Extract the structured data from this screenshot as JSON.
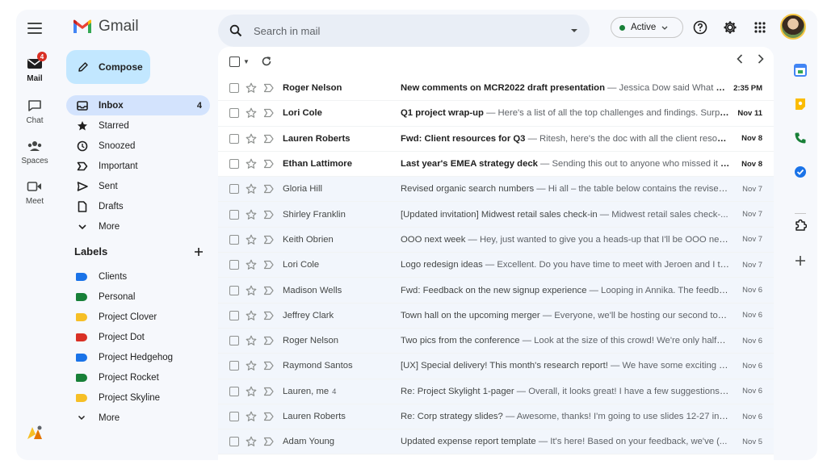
{
  "app": {
    "name": "Gmail"
  },
  "rail": {
    "items": [
      {
        "label": "Mail",
        "badge": "4"
      },
      {
        "label": "Chat"
      },
      {
        "label": "Spaces"
      },
      {
        "label": "Meet"
      }
    ]
  },
  "compose": {
    "label": "Compose"
  },
  "nav": [
    {
      "label": "Inbox",
      "count": "4",
      "icon": "inbox-icon"
    },
    {
      "label": "Starred",
      "icon": "star-icon"
    },
    {
      "label": "Snoozed",
      "icon": "clock-icon"
    },
    {
      "label": "Important",
      "icon": "important-icon"
    },
    {
      "label": "Sent",
      "icon": "send-icon"
    },
    {
      "label": "Drafts",
      "icon": "draft-icon"
    },
    {
      "label": "More",
      "icon": "chevron-down-icon"
    }
  ],
  "labels": {
    "heading": "Labels",
    "items": [
      {
        "label": "Clients",
        "color": "#1a73e8"
      },
      {
        "label": "Personal",
        "color": "#188038"
      },
      {
        "label": "Project Clover",
        "color": "#f6bf26"
      },
      {
        "label": "Project Dot",
        "color": "#d93025"
      },
      {
        "label": "Project Hedgehog",
        "color": "#1a73e8"
      },
      {
        "label": "Project Rocket",
        "color": "#188038"
      },
      {
        "label": "Project Skyline",
        "color": "#f6bf26"
      }
    ],
    "more": "More"
  },
  "search": {
    "placeholder": "Search in mail"
  },
  "status": {
    "label": "Active",
    "color": "#188038"
  },
  "emails": [
    {
      "sender": "Roger Nelson",
      "subject": "New comments on MCR2022 draft presentation",
      "snippet": " — Jessica Dow said What ab...",
      "date": "2:35 PM",
      "unread": true
    },
    {
      "sender": "Lori Cole",
      "subject": "Q1 project wrap-up",
      "snippet": " — Here's a list of all the top challenges and findings. Surpri...",
      "date": "Nov 11",
      "unread": true
    },
    {
      "sender": "Lauren Roberts",
      "subject": "Fwd: Client resources for Q3",
      "snippet": " — Ritesh, here's the doc with all the client resour...",
      "date": "Nov 8",
      "unread": true
    },
    {
      "sender": "Ethan Lattimore",
      "subject": "Last year's EMEA strategy deck",
      "snippet": " — Sending this out to anyone who missed it R...",
      "date": "Nov 8",
      "unread": true
    },
    {
      "sender": "Gloria Hill",
      "subject": "Revised organic search numbers",
      "snippet": " — Hi all – the table below contains the revised...",
      "date": "Nov 7",
      "unread": false
    },
    {
      "sender": "Shirley Franklin",
      "subject": "[Updated invitation] Midwest retail sales check-in",
      "snippet": " — Midwest retail sales check-...",
      "date": "Nov 7",
      "unread": false
    },
    {
      "sender": "Keith Obrien",
      "subject": "OOO next week",
      "snippet": " — Hey, just wanted to give you a heads-up that I'll be OOO next...",
      "date": "Nov 7",
      "unread": false
    },
    {
      "sender": "Lori Cole",
      "subject": "Logo redesign ideas",
      "snippet": " — Excellent. Do you have time to meet with Jeroen and I thi...",
      "date": "Nov 7",
      "unread": false
    },
    {
      "sender": "Madison Wells",
      "subject": "Fwd: Feedback on the new signup experience",
      "snippet": " — Looping in Annika. The feedbac...",
      "date": "Nov 6",
      "unread": false
    },
    {
      "sender": "Jeffrey Clark",
      "subject": "Town hall on the upcoming merger",
      "snippet": " — Everyone, we'll be hosting our second tow...",
      "date": "Nov 6",
      "unread": false
    },
    {
      "sender": "Roger Nelson",
      "subject": "Two pics from the conference",
      "snippet": " — Look at the size of this crowd! We're only halfw...",
      "date": "Nov 6",
      "unread": false
    },
    {
      "sender": "Raymond Santos",
      "subject": "[UX] Special delivery! This month's research report!",
      "snippet": " — We have some exciting st...",
      "date": "Nov 6",
      "unread": false
    },
    {
      "sender": "Lauren, me",
      "count": "4",
      "subject": "Re: Project Skylight 1-pager",
      "snippet": " — Overall, it looks great! I have a few suggestions fo...",
      "date": "Nov 6",
      "unread": false
    },
    {
      "sender": "Lauren Roberts",
      "subject": "Re: Corp strategy slides?",
      "snippet": " — Awesome, thanks! I'm going to use slides 12-27 in m...",
      "date": "Nov 6",
      "unread": false
    },
    {
      "sender": "Adam Young",
      "subject": "Updated expense report template",
      "snippet": " — It's here! Based on your feedback, we've (...",
      "date": "Nov 5",
      "unread": false
    }
  ]
}
